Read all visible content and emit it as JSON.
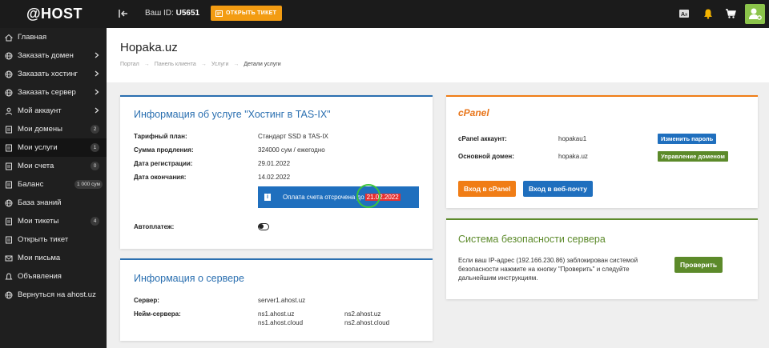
{
  "brand": {
    "logo": "@HOST"
  },
  "topbar": {
    "account_id_label": "Ваш ID:",
    "account_id_value": "U5651",
    "ticket_button": "ОТКРЫТЬ ТИКЕТ"
  },
  "colors": {
    "accent_orange": "#f39c12",
    "primary_blue": "#2a6fb0",
    "success_green": "#5c8a2a",
    "danger_red": "#e53030"
  },
  "sidebar": {
    "items": [
      {
        "label": "Главная",
        "icon": "home-icon"
      },
      {
        "label": "Заказать домен",
        "icon": "globe-icon",
        "chevron": true
      },
      {
        "label": "Заказать хостинг",
        "icon": "globe-icon",
        "chevron": true
      },
      {
        "label": "Заказать сервер",
        "icon": "globe-icon",
        "chevron": true
      },
      {
        "label": "Мой аккаунт",
        "icon": "user-icon",
        "chevron": true
      },
      {
        "label": "Мои домены",
        "icon": "doc-icon",
        "badge": "2"
      },
      {
        "label": "Мои услуги",
        "icon": "doc-icon",
        "badge": "1"
      },
      {
        "label": "Мои счета",
        "icon": "doc-icon",
        "badge": "0"
      },
      {
        "label": "Баланс",
        "icon": "doc-icon",
        "badge": "1 000 сум"
      },
      {
        "label": "База знаний",
        "icon": "globe-icon"
      },
      {
        "label": "Мои тикеты",
        "icon": "doc-icon",
        "badge": "4"
      },
      {
        "label": "Открыть тикет",
        "icon": "doc-icon"
      },
      {
        "label": "Мои письма",
        "icon": "mail-icon"
      },
      {
        "label": "Объявления",
        "icon": "bell-icon"
      },
      {
        "label": "Вернуться на ahost.uz",
        "icon": "globe-icon"
      }
    ],
    "active_index": 6
  },
  "page": {
    "title": "Hopaka.uz",
    "breadcrumb": [
      "Портал",
      "Панель клиента",
      "Услуги",
      "Детали услуги"
    ]
  },
  "service_card": {
    "title": "Информация об услуге \"Хостинг в TAS-IX\"",
    "rows": [
      {
        "label": "Тарифный план:",
        "value": "Стандарт SSD в TAS-IX"
      },
      {
        "label": "Сумма продления:",
        "value": "324000 сум / ежегодно"
      },
      {
        "label": "Дата регистрации:",
        "value": "29.01.2022"
      },
      {
        "label": "Дата окончания:",
        "value": "14.02.2022"
      }
    ],
    "notice_text": "Оплата счета отсрочена до",
    "notice_date": "21.02.2022",
    "autopay_label": "Автоплатеж:"
  },
  "server_card": {
    "title": "Информация о сервере",
    "server_label": "Сервер:",
    "server_value": "server1.ahost.uz",
    "ns_label": "Нейм-сервера:",
    "ns": [
      "ns1.ahost.uz",
      "ns2.ahost.uz",
      "ns1.ahost.cloud",
      "ns2.ahost.cloud"
    ]
  },
  "cpanel_card": {
    "logo": "cPanel",
    "account_label": "cPanel аккаунт:",
    "account_value": "hopakau1",
    "change_password": "Изменить пароль",
    "domain_label": "Основной домен:",
    "domain_value": "hopaka.uz",
    "manage_domain": "Управление доменом",
    "login_cpanel": "Вход в cPanel",
    "login_webmail": "Вход в веб-почту"
  },
  "security_card": {
    "title": "Система безопасности сервера",
    "text": "Если ваш IP-адрес (192.166.230.86) заблокирован системой безопасности нажмите на кнопку \"Проверить\" и следуйте дальнейшим инструкциям.",
    "check_button": "Проверить"
  }
}
